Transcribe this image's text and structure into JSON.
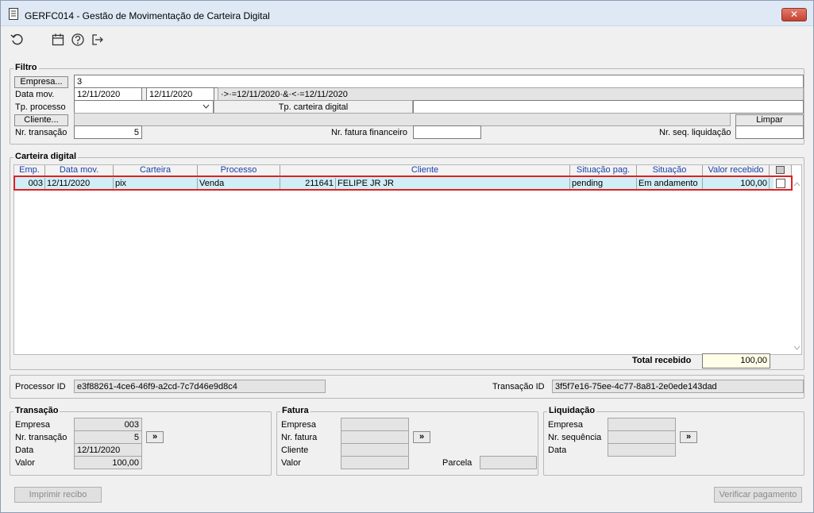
{
  "window": {
    "title": "GERFC014 - Gestão de Movimentação de Carteira Digital",
    "close": "✕"
  },
  "filtro": {
    "title": "Filtro",
    "empresa_btn": "Empresa...",
    "empresa_value": "3",
    "data_mov_label": "Data mov.",
    "data_mov_from": "12/11/2020",
    "data_mov_to": "12/11/2020",
    "data_mov_expr": "·>·=12/11/2020·&·<·=12/11/2020",
    "tp_processo_label": "Tp. processo",
    "tp_carteira_label": "Tp. carteira digital",
    "cliente_btn": "Cliente...",
    "limpar_btn": "Limpar",
    "nr_transacao_label": "Nr. transação",
    "nr_transacao_value": "5",
    "nr_fatura_label": "Nr. fatura financeiro",
    "nr_seq_label": "Nr. seq. liquidação"
  },
  "carteira": {
    "title": "Carteira digital",
    "columns": [
      "Emp.",
      "Data mov.",
      "Carteira",
      "Processo",
      "Cliente",
      "Situação pag.",
      "Situação",
      "Valor recebido"
    ],
    "rows": [
      {
        "emp": "003",
        "data": "12/11/2020",
        "carteira": "pix",
        "processo": "Venda",
        "cliente_cod": "211641",
        "cliente_nome": "FELIPE JR JR",
        "sit_pag": "pending",
        "situacao": "Em andamento",
        "valor": "100,00"
      }
    ],
    "total_label": "Total recebido",
    "total_value": "100,00"
  },
  "ids": {
    "processor_label": "Processor ID",
    "processor_value": "e3f88261-4ce6-46f9-a2cd-7c7d46e9d8c4",
    "transacao_label": "Transação ID",
    "transacao_value": "3f5f7e16-75ee-4c77-8a81-2e0ede143dad"
  },
  "transacao": {
    "title": "Transação",
    "empresa_label": "Empresa",
    "empresa_value": "003",
    "nr_label": "Nr. transação",
    "nr_value": "5",
    "data_label": "Data",
    "data_value": "12/11/2020",
    "valor_label": "Valor",
    "valor_value": "100,00"
  },
  "fatura": {
    "title": "Fatura",
    "empresa_label": "Empresa",
    "nr_label": "Nr. fatura",
    "cliente_label": "Cliente",
    "valor_label": "Valor",
    "parcela_label": "Parcela"
  },
  "liquidacao": {
    "title": "Liquidação",
    "empresa_label": "Empresa",
    "nr_label": "Nr. sequência",
    "data_label": "Data"
  },
  "footer": {
    "imprimir": "Imprimir recibo",
    "verificar": "Verificar pagamento"
  },
  "arrow": "»"
}
